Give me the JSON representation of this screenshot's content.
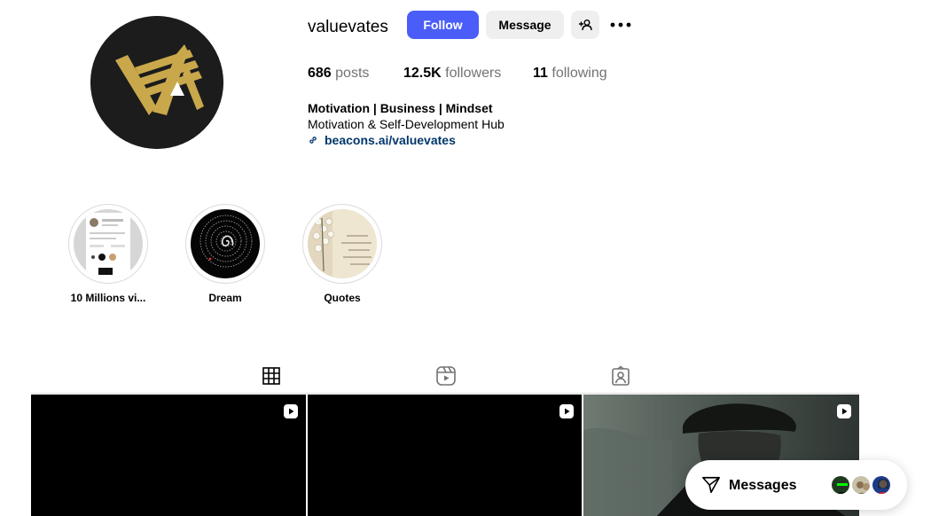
{
  "profile": {
    "username": "valuevates",
    "follow_label": "Follow",
    "message_label": "Message",
    "add_user_icon": "person-plus-icon",
    "more_icon": "ellipsis-icon",
    "avatar_icon": "logo-va-icon",
    "colors": {
      "follow_bg": "#4a5df9",
      "logo_gold": "#c9a84c",
      "link": "#00376b"
    }
  },
  "stats": {
    "posts_count": "686",
    "posts_label": "posts",
    "followers_count": "12.5K",
    "followers_label": "followers",
    "following_count": "11",
    "following_label": "following"
  },
  "bio": {
    "name": "Motivation | Business | Mindset",
    "description": "Motivation & Self-Development Hub",
    "link": "beacons.ai/valuevates",
    "link_icon": "link-icon"
  },
  "highlights": [
    {
      "label": "10 Millions vi..."
    },
    {
      "label": "Dream"
    },
    {
      "label": "Quotes"
    }
  ],
  "tabs": [
    {
      "icon": "grid-icon",
      "active": true
    },
    {
      "icon": "reels-icon",
      "active": false
    },
    {
      "icon": "tagged-icon",
      "active": false
    }
  ],
  "posts": [
    {
      "type": "reel",
      "badge_icon": "reel-icon"
    },
    {
      "type": "reel",
      "badge_icon": "reel-icon"
    },
    {
      "type": "reel",
      "badge_icon": "reel-icon"
    }
  ],
  "messages": {
    "label": "Messages",
    "icon": "send-icon"
  }
}
